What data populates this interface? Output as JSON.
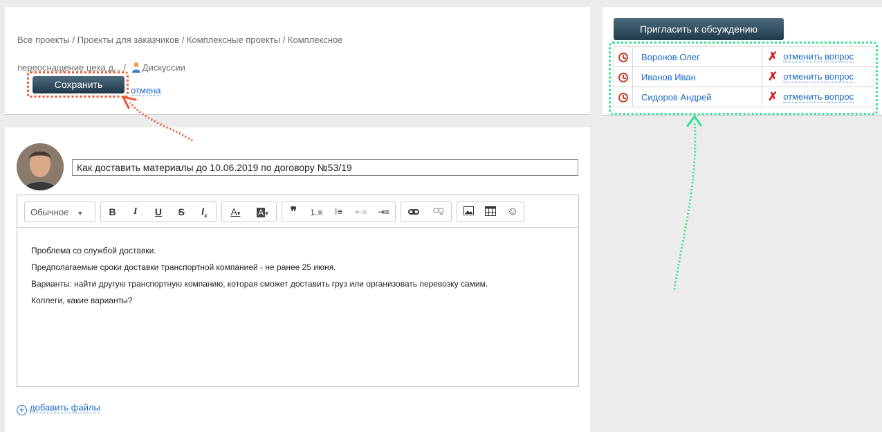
{
  "breadcrumb": {
    "line1": "Все проекты / Проекты для заказчиков / Комплексные проекты / Комплексное",
    "line2": "переоснащение цеха д... / ",
    "current": "Дискуссии"
  },
  "actions": {
    "save_label": "Сохранить",
    "cancel_label": "отмена"
  },
  "invite": {
    "button_label": "Пригласить к обсуждению",
    "participants": [
      {
        "name": "Воронов Олег",
        "action": "отменить вопрос"
      },
      {
        "name": "Иванов Иван",
        "action": "отменить вопрос"
      },
      {
        "name": "Сидоров Андрей",
        "action": "отменить вопрос"
      }
    ]
  },
  "editor": {
    "subject": "Как доставить материалы до 10.06.2019 по договору №53/19",
    "format_label": "Обычное",
    "body_lines": [
      "Проблема со службой доставки.",
      "Предполагаемые сроки доставки транспортной компанией - не ранее 25 июня.",
      "Варианты: найти другую транспортную компанию, которая сможет доставить груз или организовать перевозку самим.",
      "Коллеги, какие варианты?"
    ]
  },
  "add_files_label": "добавить файлы",
  "colors": {
    "accent_link": "#1a6ac7",
    "highlight_save": "#ee5533",
    "highlight_list": "#2ee58c",
    "button_dark": "#2b4a5c"
  }
}
